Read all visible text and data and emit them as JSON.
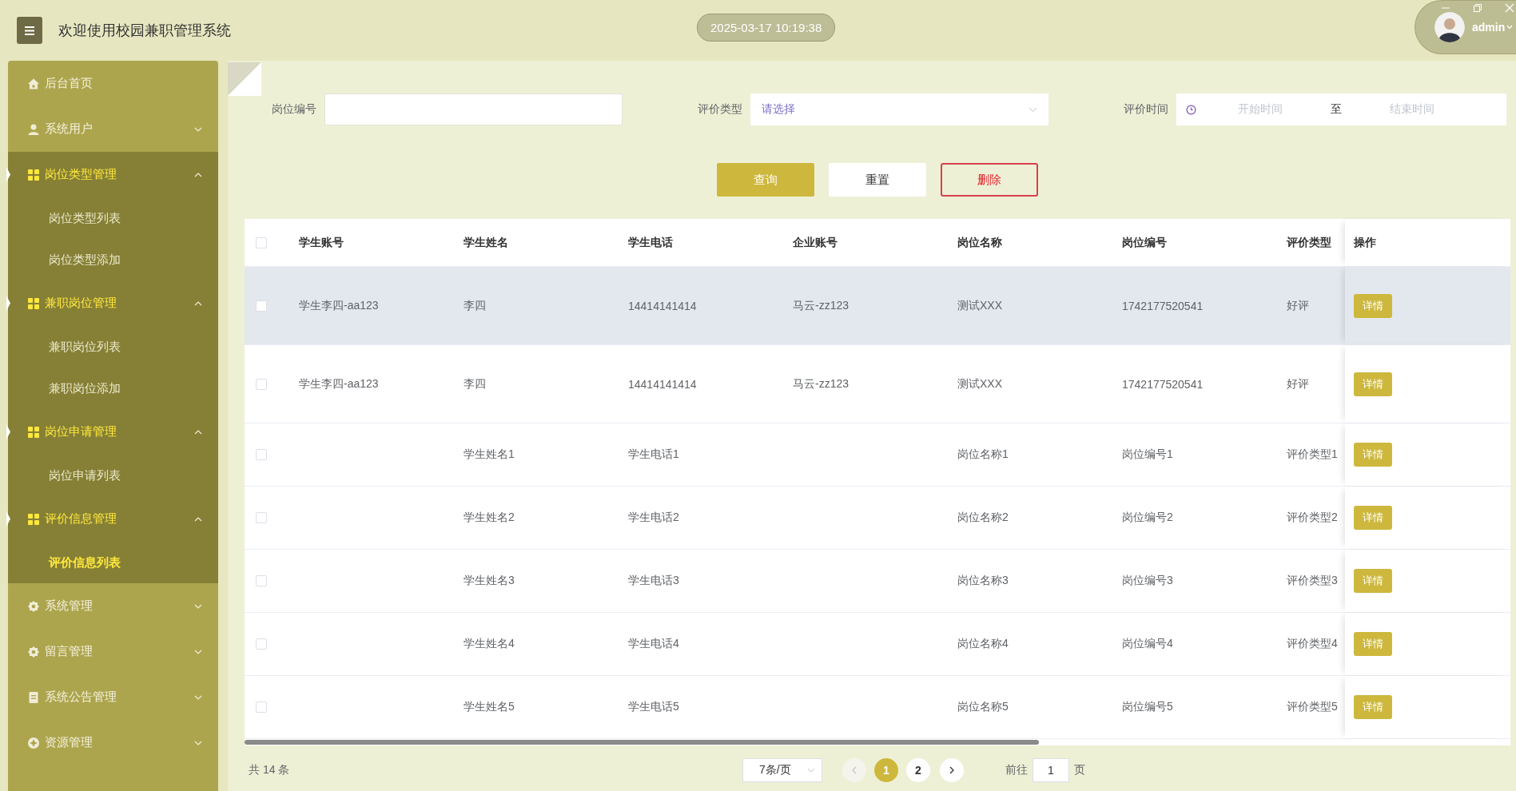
{
  "header": {
    "title": "欢迎使用校园兼职管理系统",
    "datetime": "2025-03-17 10:19:38",
    "user": "admin"
  },
  "sidebar": {
    "items": [
      {
        "label": "后台首页",
        "kind": "link"
      },
      {
        "label": "系统用户",
        "kind": "group",
        "expanded": false
      },
      {
        "label": "岗位类型管理",
        "kind": "group",
        "expanded": true,
        "children": [
          {
            "label": "岗位类型列表",
            "selected": false
          },
          {
            "label": "岗位类型添加",
            "selected": false
          }
        ]
      },
      {
        "label": "兼职岗位管理",
        "kind": "group",
        "expanded": true,
        "children": [
          {
            "label": "兼职岗位列表",
            "selected": false
          },
          {
            "label": "兼职岗位添加",
            "selected": false
          }
        ]
      },
      {
        "label": "岗位申请管理",
        "kind": "group",
        "expanded": true,
        "children": [
          {
            "label": "岗位申请列表",
            "selected": false
          }
        ]
      },
      {
        "label": "评价信息管理",
        "kind": "group",
        "expanded": true,
        "children": [
          {
            "label": "评价信息列表",
            "selected": true
          }
        ]
      },
      {
        "label": "系统管理",
        "kind": "group",
        "expanded": false
      },
      {
        "label": "留言管理",
        "kind": "group",
        "expanded": false
      },
      {
        "label": "系统公告管理",
        "kind": "group",
        "expanded": false
      },
      {
        "label": "资源管理",
        "kind": "group",
        "expanded": false
      }
    ]
  },
  "filters": [
    {
      "label": "岗位编号",
      "kind": "text"
    },
    {
      "label": "评价类型",
      "kind": "select",
      "placeholder": "请选择"
    },
    {
      "label": "评价时间",
      "kind": "daterange",
      "start_placeholder": "开始时间",
      "separator": "至",
      "end_placeholder": "结束时间"
    }
  ],
  "buttons": [
    {
      "label": "查询",
      "kind": "primary"
    },
    {
      "label": "重置",
      "kind": "default"
    },
    {
      "label": "删除",
      "kind": "danger"
    }
  ],
  "table": {
    "select_all": false,
    "columns": [
      "学生账号",
      "学生姓名",
      "学生电话",
      "企业账号",
      "岗位名称",
      "岗位编号",
      "评价类型"
    ],
    "action_column": "操作",
    "rows": [
      {
        "checked": false,
        "highlighted": true,
        "cells": [
          "学生李四-aa123",
          "李四",
          "14414141414",
          "马云-zz123",
          "测试XXX",
          "1742177520541",
          "好评"
        ],
        "action": "详情"
      },
      {
        "checked": false,
        "highlighted": false,
        "cells": [
          "学生李四-aa123",
          "李四",
          "14414141414",
          "马云-zz123",
          "测试XXX",
          "1742177520541",
          "好评"
        ],
        "action": "详情"
      },
      {
        "checked": false,
        "highlighted": false,
        "cells": [
          null,
          "学生姓名1",
          "学生电话1",
          null,
          "岗位名称1",
          "岗位编号1",
          "评价类型1"
        ],
        "action": "详情"
      },
      {
        "checked": false,
        "highlighted": false,
        "cells": [
          null,
          "学生姓名2",
          "学生电话2",
          null,
          "岗位名称2",
          "岗位编号2",
          "评价类型2"
        ],
        "action": "详情"
      },
      {
        "checked": false,
        "highlighted": false,
        "cells": [
          null,
          "学生姓名3",
          "学生电话3",
          null,
          "岗位名称3",
          "岗位编号3",
          "评价类型3"
        ],
        "action": "详情"
      },
      {
        "checked": false,
        "highlighted": false,
        "cells": [
          null,
          "学生姓名4",
          "学生电话4",
          null,
          "岗位名称4",
          "岗位编号4",
          "评价类型4"
        ],
        "action": "详情"
      },
      {
        "checked": false,
        "highlighted": false,
        "cells": [
          null,
          "学生姓名5",
          "学生电话5",
          null,
          "岗位名称5",
          "岗位编号5",
          "评价类型5"
        ],
        "action": "详情"
      }
    ]
  },
  "pagination": {
    "total": "共 14 条",
    "page_size": "7条/页",
    "pages": [
      {
        "label": "1",
        "selected": true
      },
      {
        "label": "2",
        "selected": false
      }
    ],
    "goto_label": "前往",
    "goto_value": "1",
    "goto_suffix": "页"
  }
}
